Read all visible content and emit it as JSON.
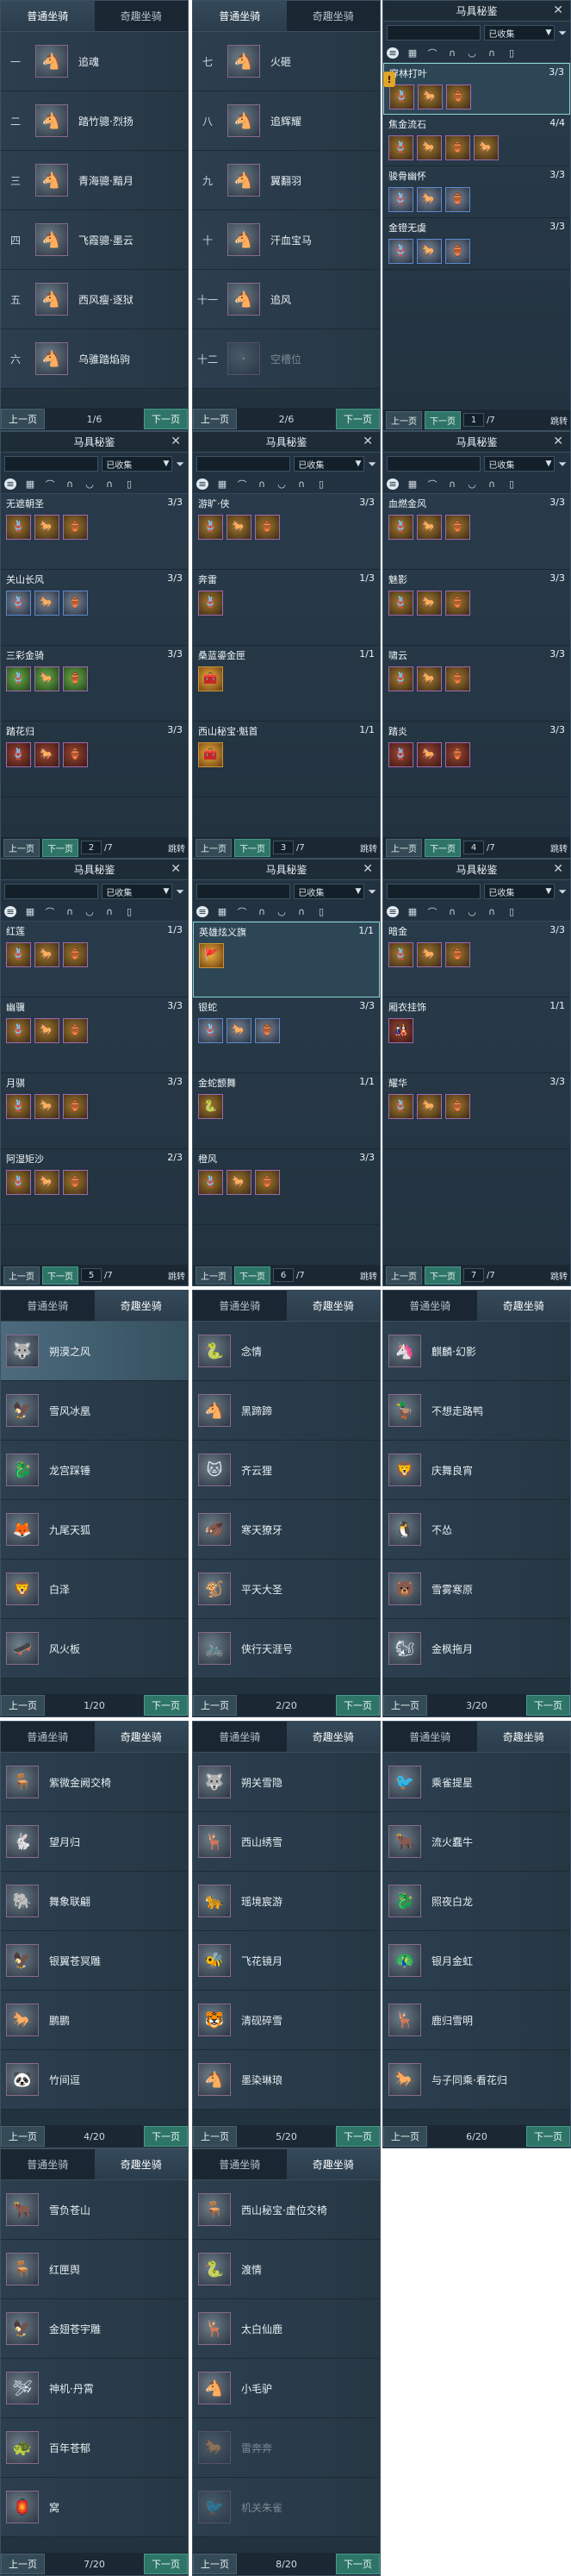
{
  "mount_tabs": {
    "normal": "普通坐骑",
    "fun": "奇趣坐骑"
  },
  "pager_labels": {
    "prev": "上一页",
    "next": "下一页",
    "jump": "跳转"
  },
  "harness": {
    "title": "马具秘鉴",
    "filter": "已收集",
    "total_pages": "/7",
    "close": "✕"
  },
  "mount_panels": [
    {
      "page": "1/6",
      "rows": [
        {
          "num": "一",
          "name": "追魂",
          "icon": "🐴"
        },
        {
          "num": "二",
          "name": "踏竹骢·烈扬",
          "icon": "🐴"
        },
        {
          "num": "三",
          "name": "青海骢·黯月",
          "icon": "🐴"
        },
        {
          "num": "四",
          "name": "飞霞骢·墨云",
          "icon": "🐴"
        },
        {
          "num": "五",
          "name": "西风瘦·逐狱",
          "icon": "🐴"
        },
        {
          "num": "六",
          "name": "乌骓踏焰驹",
          "icon": "🐴"
        }
      ]
    },
    {
      "page": "2/6",
      "rows": [
        {
          "num": "七",
          "name": "火砸",
          "icon": "🐴"
        },
        {
          "num": "八",
          "name": "追辉耀",
          "icon": "🐴"
        },
        {
          "num": "九",
          "name": "翼翻羽",
          "icon": "🐴"
        },
        {
          "num": "十",
          "name": "汗血宝马",
          "icon": "🐴"
        },
        {
          "num": "十一",
          "name": "追风",
          "icon": "🐴"
        },
        {
          "num": "十二",
          "name": "空槽位",
          "icon": "·"
        }
      ]
    }
  ],
  "harness_panels": [
    {
      "page": "1",
      "sections": [
        {
          "name": "穿林打叶",
          "count": "3/3",
          "items": [
            "🪢",
            "🐎",
            "🏺"
          ],
          "style": ""
        },
        {
          "name": "焦金流石",
          "count": "4/4",
          "items": [
            "🪢",
            "🐎",
            "🏺",
            "🐎"
          ],
          "style": ""
        },
        {
          "name": "骏骨幽怀",
          "count": "3/3",
          "items": [
            "🪢",
            "🐎",
            "🏺"
          ],
          "style": "b"
        },
        {
          "name": "金镫无虞",
          "count": "3/3",
          "items": [
            "🪢",
            "🐎",
            "🏺"
          ],
          "style": "b"
        }
      ]
    },
    {
      "page": "2",
      "sections": [
        {
          "name": "无遮朝圣",
          "count": "3/3",
          "items": [
            "🪢",
            "🐎",
            "🏺"
          ],
          "style": ""
        },
        {
          "name": "关山长风",
          "count": "3/3",
          "items": [
            "🪢",
            "🐎",
            "🏺"
          ],
          "style": "b"
        },
        {
          "name": "三彩金骑",
          "count": "3/3",
          "items": [
            "🪢",
            "🐎",
            "🏺"
          ],
          "style": "gr"
        },
        {
          "name": "踏花归",
          "count": "3/3",
          "items": [
            "🪢",
            "🐎",
            "🏺"
          ],
          "style": "r"
        }
      ]
    },
    {
      "page": "3",
      "sections": [
        {
          "name": "游旷·侠",
          "count": "3/3",
          "items": [
            "🪢",
            "🐎",
            "🏺"
          ],
          "style": ""
        },
        {
          "name": "奔雷",
          "count": "1/3",
          "items": [
            "🪢"
          ],
          "style": ""
        },
        {
          "name": "桑蓝鎏金匣",
          "count": "1/1",
          "items": [
            "🧰"
          ],
          "style": "g"
        },
        {
          "name": "西山秘宝·魁首",
          "count": "1/1",
          "items": [
            "🧰"
          ],
          "style": "g"
        }
      ]
    },
    {
      "page": "4",
      "sections": [
        {
          "name": "血燃金风",
          "count": "3/3",
          "items": [
            "🪢",
            "🐎",
            "🏺"
          ],
          "style": ""
        },
        {
          "name": "魅影",
          "count": "3/3",
          "items": [
            "🪢",
            "🐎",
            "🏺"
          ],
          "style": ""
        },
        {
          "name": "啸云",
          "count": "3/3",
          "items": [
            "🪢",
            "🐎",
            "🏺"
          ],
          "style": ""
        },
        {
          "name": "踏炎",
          "count": "3/3",
          "items": [
            "🪢",
            "🐎",
            "🏺"
          ],
          "style": "r"
        }
      ]
    },
    {
      "page": "5",
      "sections": [
        {
          "name": "红莲",
          "count": "1/3",
          "items": [
            "🪢",
            "🐎",
            "🏺"
          ],
          "style": ""
        },
        {
          "name": "幽骥",
          "count": "3/3",
          "items": [
            "🪢",
            "🐎",
            "🏺"
          ],
          "style": ""
        },
        {
          "name": "月骐",
          "count": "3/3",
          "items": [
            "🪢",
            "🐎",
            "🏺"
          ],
          "style": ""
        },
        {
          "name": "阿湿矩沙",
          "count": "2/3",
          "items": [
            "🪢",
            "🐎",
            "🏺"
          ],
          "style": ""
        }
      ]
    },
    {
      "page": "6",
      "sections": [
        {
          "name": "英雄炫义旗",
          "count": "1/1",
          "items": [
            "🚩"
          ],
          "style": "g"
        },
        {
          "name": "银蛇",
          "count": "3/3",
          "items": [
            "🪢",
            "🐎",
            "🏺"
          ],
          "style": "b"
        },
        {
          "name": "金蛇颤舞",
          "count": "1/1",
          "items": [
            "🐍"
          ],
          "style": ""
        },
        {
          "name": "橙风",
          "count": "3/3",
          "items": [
            "🪢",
            "🐎",
            "🏺"
          ],
          "style": ""
        }
      ]
    },
    {
      "page": "7",
      "sections": [
        {
          "name": "暗金",
          "count": "3/3",
          "items": [
            "🪢",
            "🐎",
            "🏺"
          ],
          "style": ""
        },
        {
          "name": "厢衣挂饰",
          "count": "1/1",
          "items": [
            "🎎"
          ],
          "style": "r"
        },
        {
          "name": "耀华",
          "count": "3/3",
          "items": [
            "🪢",
            "🐎",
            "🏺"
          ],
          "style": ""
        }
      ]
    }
  ],
  "fun_panels": [
    {
      "page": "1/20",
      "rows": [
        {
          "name": "朔漠之风",
          "icon": "🐺"
        },
        {
          "name": "雪风冰凰",
          "icon": "🦅"
        },
        {
          "name": "龙宫踩锤",
          "icon": "🐉"
        },
        {
          "name": "九尾天狐",
          "icon": "🦊"
        },
        {
          "name": "白泽",
          "icon": "🦁"
        },
        {
          "name": "风火板",
          "icon": "🛹"
        }
      ]
    },
    {
      "page": "2/20",
      "rows": [
        {
          "name": "念情",
          "icon": "🐍"
        },
        {
          "name": "黑蹄蹄",
          "icon": "🐴"
        },
        {
          "name": "齐云狸",
          "icon": "🐱"
        },
        {
          "name": "寒天獠牙",
          "icon": "🐗"
        },
        {
          "name": "平天大圣",
          "icon": "🐒"
        },
        {
          "name": "侠行天涯号",
          "icon": "🚲"
        }
      ]
    },
    {
      "page": "3/20",
      "rows": [
        {
          "name": "麒麟·幻影",
          "icon": "🦄"
        },
        {
          "name": "不想走路鸭",
          "icon": "🦆"
        },
        {
          "name": "庆舞良宵",
          "icon": "🦁"
        },
        {
          "name": "不怂",
          "icon": "🐧"
        },
        {
          "name": "雪雾寒原",
          "icon": "🐻"
        },
        {
          "name": "金枫拖月",
          "icon": "🐿"
        }
      ]
    },
    {
      "page": "4/20",
      "rows": [
        {
          "name": "紫微金阙交椅",
          "icon": "🪑"
        },
        {
          "name": "望月归",
          "icon": "🐇"
        },
        {
          "name": "舞象联翩",
          "icon": "🐘"
        },
        {
          "name": "银翼苍冥雕",
          "icon": "🦅"
        },
        {
          "name": "鹏鹏",
          "icon": "🐎"
        },
        {
          "name": "竹间逗",
          "icon": "🐼"
        }
      ]
    },
    {
      "page": "5/20",
      "rows": [
        {
          "name": "朔关雪隐",
          "icon": "🐺"
        },
        {
          "name": "西山绣雪",
          "icon": "🦌"
        },
        {
          "name": "瑶境宸游",
          "icon": "🐆"
        },
        {
          "name": "飞花镜月",
          "icon": "🐝"
        },
        {
          "name": "清砚碎雪",
          "icon": "🐯"
        },
        {
          "name": "墨染琳琅",
          "icon": "🐴"
        }
      ]
    },
    {
      "page": "6/20",
      "rows": [
        {
          "name": "乘雀提星",
          "icon": "🐦"
        },
        {
          "name": "流火蠢牛",
          "icon": "🐂"
        },
        {
          "name": "照夜白龙",
          "icon": "🐉"
        },
        {
          "name": "银月金虹",
          "icon": "🦚"
        },
        {
          "name": "鹿归雪明",
          "icon": "🦌"
        },
        {
          "name": "与子同乘·看花归",
          "icon": "🐎"
        }
      ]
    },
    {
      "page": "7/20",
      "rows": [
        {
          "name": "雪负苍山",
          "icon": "🐂"
        },
        {
          "name": "红匣舆",
          "icon": "🪑"
        },
        {
          "name": "金翅苍宇雕",
          "icon": "🦅"
        },
        {
          "name": "神机·丹霄",
          "icon": "🛩"
        },
        {
          "name": "百年苍郁",
          "icon": "🐢"
        },
        {
          "name": "窝",
          "icon": "🏮"
        }
      ]
    },
    {
      "page": "8/20",
      "rows": [
        {
          "name": "西山秘宝·虚位交椅",
          "icon": "🪑"
        },
        {
          "name": "渡情",
          "icon": "🐍"
        },
        {
          "name": "太白仙鹿",
          "icon": "🦌"
        },
        {
          "name": "小毛驴",
          "icon": "🐴"
        },
        {
          "name": "雷奔奔",
          "icon": "🐎"
        },
        {
          "name": "机关朱雀",
          "icon": "🐦"
        }
      ]
    }
  ]
}
